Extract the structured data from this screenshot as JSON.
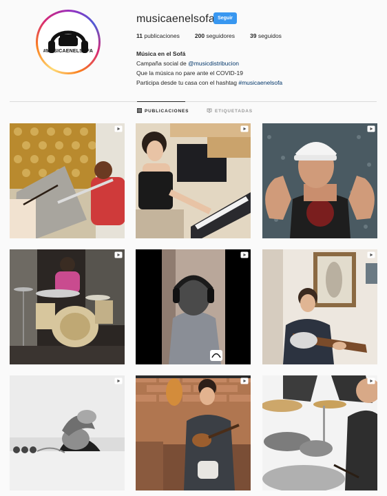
{
  "profile": {
    "username": "musicaenelsofa",
    "follow_label": "Seguir",
    "avatar_text": "#MUSICAENELSOFA",
    "stats": {
      "posts_count": "11",
      "posts_label": "publicaciones",
      "followers_count": "200",
      "followers_label": "seguidores",
      "following_count": "39",
      "following_label": "seguidos"
    },
    "bio": {
      "name": "Música en el Sofá",
      "line1_prefix": "Campaña social de ",
      "line1_mention": "@musicdistribucion",
      "line2": "Que la música no pare ante el COVID-19",
      "line3_prefix": "Participa desde tu casa con el hashtag ",
      "line3_hashtag": "#musicaenelsofa"
    }
  },
  "tabs": [
    {
      "label": "PUBLICACIONES",
      "icon": "grid-icon"
    },
    {
      "label": "ETIQUETADAS",
      "icon": "tag-icon"
    }
  ],
  "posts": [
    {
      "scene": "man playing flute with drumsticks",
      "icon": "video-icon"
    },
    {
      "scene": "woman playing keyboard",
      "icon": "video-icon"
    },
    {
      "scene": "man in white cap with open hands",
      "icon": "video-icon"
    },
    {
      "scene": "drummer in studio",
      "icon": "video-icon"
    },
    {
      "scene": "man wearing headphones from behind",
      "icon": "video-icon"
    },
    {
      "scene": "man playing electric guitar",
      "icon": "video-icon"
    },
    {
      "scene": "man reaching toward camera, black and white",
      "icon": "video-icon"
    },
    {
      "scene": "man playing ukulele on sofa",
      "icon": "video-icon"
    },
    {
      "scene": "drummer with cymbals",
      "icon": "video-icon"
    }
  ],
  "colors": {
    "accent": "#3897f0",
    "link": "#003569",
    "text": "#262626",
    "muted": "#999999",
    "divider": "#dbdbdb",
    "background": "#fafafa"
  }
}
